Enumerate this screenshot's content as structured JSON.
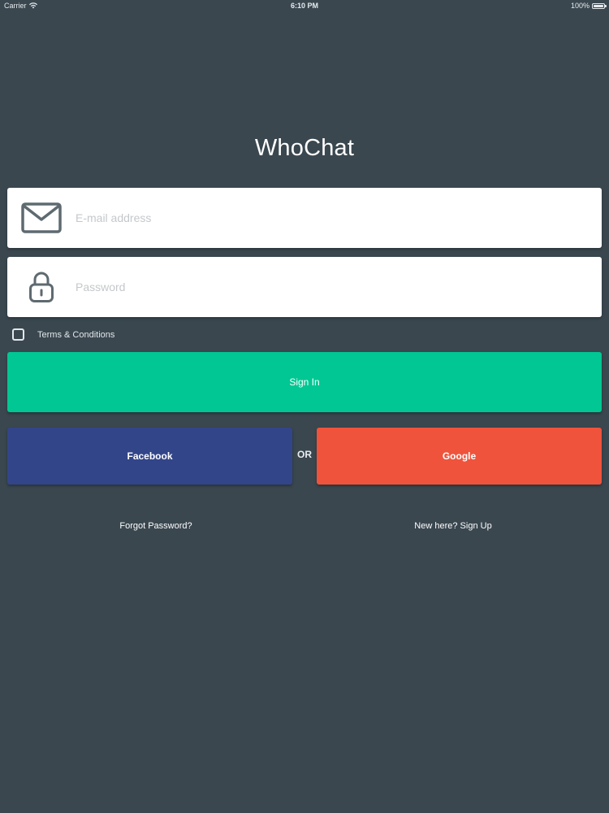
{
  "status_bar": {
    "carrier": "Carrier",
    "time": "6:10 PM",
    "battery": "100%"
  },
  "app": {
    "title": "WhoChat"
  },
  "form": {
    "email": {
      "placeholder": "E-mail address",
      "value": "",
      "icon": "envelope-icon"
    },
    "password": {
      "placeholder": "Password",
      "value": "",
      "icon": "lock-icon"
    },
    "terms": {
      "label": "Terms & Conditions",
      "checked": false
    },
    "signin_label": "Sign In"
  },
  "social": {
    "facebook_label": "Facebook",
    "or_label": "OR",
    "google_label": "Google"
  },
  "links": {
    "forgot_password": "Forgot Password?",
    "sign_up": "New here? Sign Up"
  },
  "colors": {
    "background": "#3a474f",
    "signin": "#00c793",
    "facebook": "#334589",
    "google": "#ef533c",
    "field_bg": "#ffffff"
  }
}
